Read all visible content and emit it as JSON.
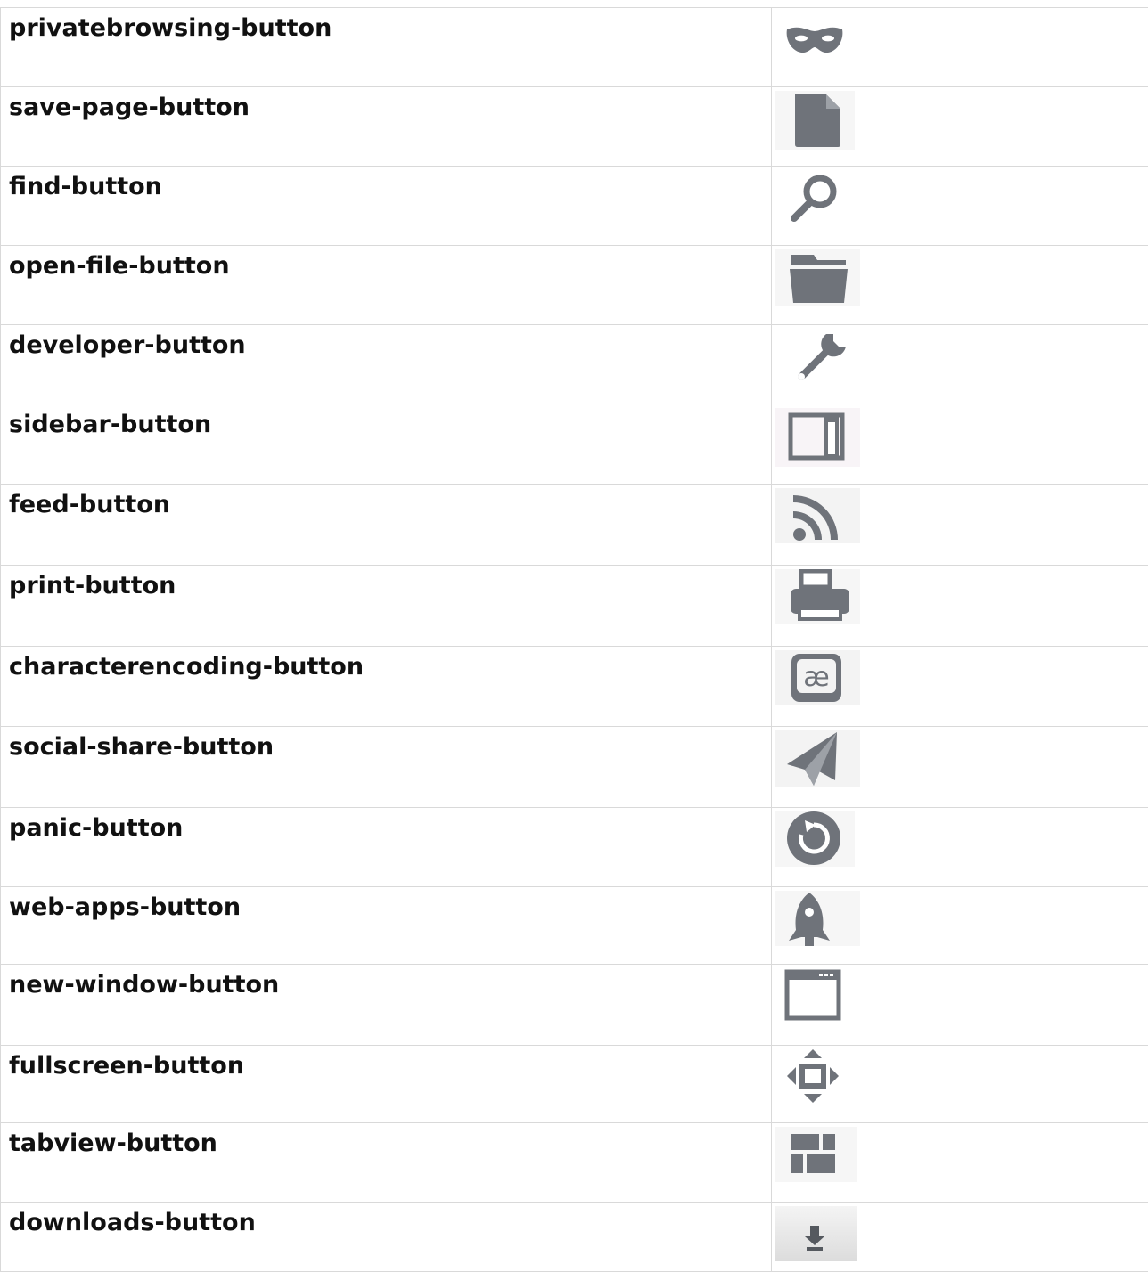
{
  "rows": [
    {
      "label": "privatebrowsing-button",
      "icon": "private-browsing-mask-icon"
    },
    {
      "label": "save-page-button",
      "icon": "save-page-document-icon"
    },
    {
      "label": "find-button",
      "icon": "find-magnifier-icon"
    },
    {
      "label": "open-file-button",
      "icon": "open-file-folder-icon"
    },
    {
      "label": "developer-button",
      "icon": "developer-wrench-icon"
    },
    {
      "label": "sidebar-button",
      "icon": "sidebar-panel-icon"
    },
    {
      "label": "feed-button",
      "icon": "feed-rss-icon"
    },
    {
      "label": "print-button",
      "icon": "print-printer-icon"
    },
    {
      "label": "characterencoding-button",
      "icon": "character-encoding-ae-icon"
    },
    {
      "label": "social-share-button",
      "icon": "social-share-paper-plane-icon"
    },
    {
      "label": "panic-button",
      "icon": "panic-forget-icon"
    },
    {
      "label": "web-apps-button",
      "icon": "web-apps-rocket-icon"
    },
    {
      "label": "new-window-button",
      "icon": "new-window-icon"
    },
    {
      "label": "fullscreen-button",
      "icon": "fullscreen-arrows-icon"
    },
    {
      "label": "tabview-button",
      "icon": "tabview-grid-icon"
    },
    {
      "label": "downloads-button",
      "icon": "downloads-arrow-icon"
    }
  ],
  "colors": {
    "icon_gray": "#6f737a",
    "grid_line": "#d9d9d9",
    "icon_backdrop": "#f4f4f4"
  }
}
